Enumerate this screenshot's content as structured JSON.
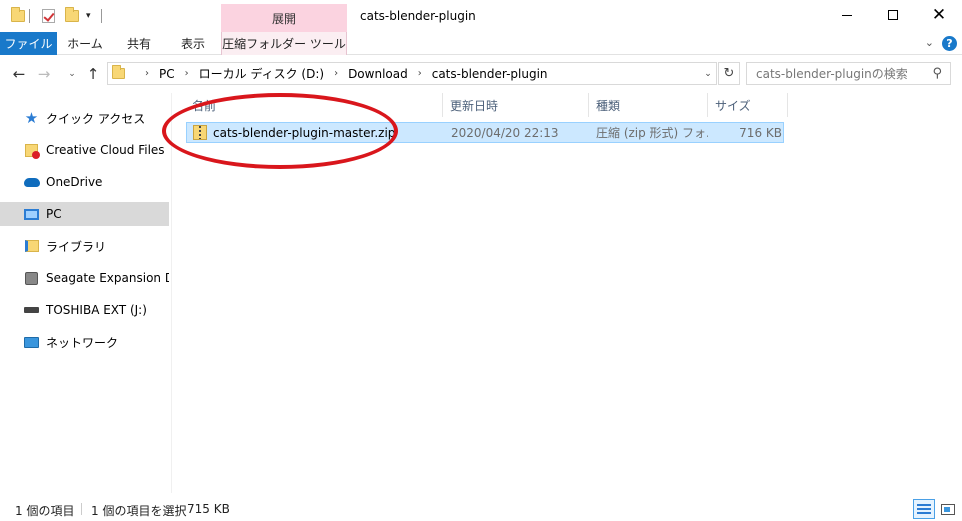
{
  "window": {
    "title": "cats-blender-plugin",
    "context_group": "展開",
    "controls": {
      "minimize_icon": "minimize-icon",
      "maximize_icon": "maximize-icon",
      "close_icon": "close-icon",
      "close_glyph": "✕"
    }
  },
  "quick_access": {
    "icons": [
      "folder-icon",
      "properties-check-icon",
      "new-folder-icon",
      "customize-dropdown-icon"
    ],
    "dropdown_glyph": "▾"
  },
  "ribbon": {
    "tabs": [
      "ファイル",
      "ホーム",
      "共有",
      "表示",
      "圧縮フォルダー ツール"
    ],
    "expand_glyph": "⌄",
    "help_glyph": "?"
  },
  "nav_buttons": {
    "back": "←",
    "forward": "→",
    "recent": "⌄",
    "up": "↑"
  },
  "address": {
    "breadcrumbs": [
      "PC",
      "ローカル ディスク (D:)",
      "Download",
      "cats-blender-plugin"
    ],
    "separator": "›",
    "dropdown_glyph": "⌄",
    "refresh_glyph": "↻"
  },
  "search": {
    "placeholder": "cats-blender-pluginの検索",
    "icon_glyph": "⚲"
  },
  "nav_pane": {
    "items": [
      {
        "label": "クイック アクセス",
        "icon": "star-icon",
        "glyph": "★"
      },
      {
        "label": "Creative Cloud Files",
        "icon": "creative-cloud-folder-icon"
      },
      {
        "label": "OneDrive",
        "icon": "onedrive-cloud-icon"
      },
      {
        "label": "PC",
        "icon": "pc-icon",
        "selected": true
      },
      {
        "label": "ライブラリ",
        "icon": "library-icon"
      },
      {
        "label": "Seagate Expansion Drive",
        "icon": "drive-disk-icon"
      },
      {
        "label": "TOSHIBA EXT (J:)",
        "icon": "external-drive-icon"
      },
      {
        "label": "ネットワーク",
        "icon": "network-icon"
      }
    ]
  },
  "file_list": {
    "columns": [
      "名前",
      "更新日時",
      "種類",
      "サイズ"
    ],
    "rows": [
      {
        "name": "cats-blender-plugin-master.zip",
        "modified": "2020/04/20 22:13",
        "type": "圧縮 (zip 形式) フォ...",
        "size": "716 KB",
        "icon": "zip-folder-icon",
        "selected": true
      }
    ]
  },
  "annotation": {
    "color": "#d9161c",
    "shape": "ellipse"
  },
  "status_bar": {
    "item_count": "1 個の項目",
    "selection": "1 個の項目を選択",
    "selection_size": "715 KB",
    "view_icons": [
      "details-view-icon",
      "large-icons-view-icon"
    ]
  },
  "colors": {
    "file_tab": "#1979ca",
    "context_tab": "#fbd3e0",
    "selection": "#cce8ff",
    "nav_selected": "#d9d9d9"
  }
}
